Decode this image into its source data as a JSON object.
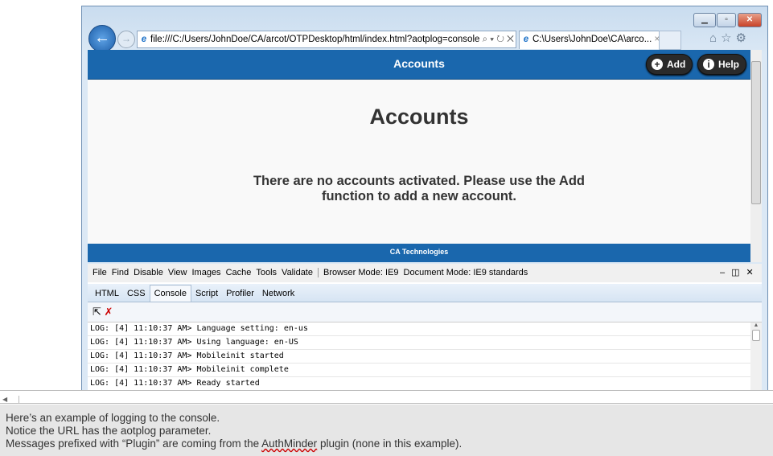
{
  "browser": {
    "url": "file:///C:/Users/JohnDoe/CA/arcot/OTPDesktop/html/index.html?aotplog=console",
    "tab_title": "C:\\Users\\JohnDoe\\CA\\arco...",
    "tab_close": "×",
    "addr_controls": "⌕ ▾ ↻ ✕"
  },
  "app": {
    "header_title": "Accounts",
    "add_label": "Add",
    "help_label": "Help",
    "page_title": "Accounts",
    "message": "There are no accounts activated. Please use the Add function to add a new account.",
    "footer": "CA Technologies"
  },
  "devtools": {
    "menu": [
      "File",
      "Find",
      "Disable",
      "View",
      "Images",
      "Cache",
      "Tools",
      "Validate"
    ],
    "browser_mode": "Browser Mode: IE9",
    "document_mode": "Document Mode: IE9 standards",
    "tabs": [
      "HTML",
      "CSS",
      "Console",
      "Script",
      "Profiler",
      "Network"
    ],
    "log": [
      "LOG: [4] 11:10:37 AM> Language setting: en-us",
      "LOG: [4] 11:10:37 AM> Using language: en-US",
      "LOG: [4] 11:10:37 AM> Mobileinit started",
      "LOG: [4] 11:10:37 AM> Mobileinit complete",
      "LOG: [4] 11:10:37 AM> Ready started"
    ]
  },
  "caption": {
    "line1": "Here’s an example of logging to the console.",
    "line2": "Notice the URL has the aotplog parameter.",
    "line3a": "Messages prefixed with “Plugin” are coming from the ",
    "line3b": "AuthMinder",
    "line3c": " plugin (none in this example)."
  }
}
